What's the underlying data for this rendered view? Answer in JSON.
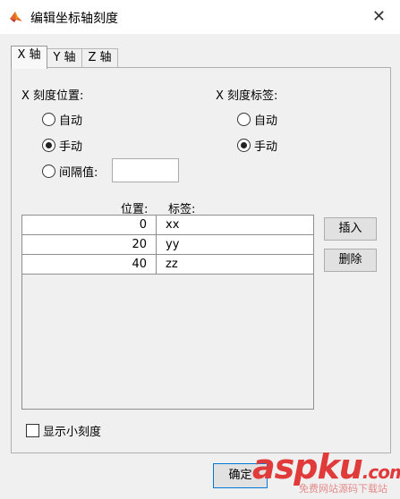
{
  "window": {
    "title": "编辑坐标轴刻度",
    "close": "✕"
  },
  "tabs": [
    {
      "label": "X 轴"
    },
    {
      "label": "Y 轴"
    },
    {
      "label": "Z 轴"
    }
  ],
  "positions": {
    "heading": "X 刻度位置:",
    "auto": "自动",
    "manual": "手动",
    "interval": "间隔值:",
    "interval_value": "",
    "selected": "manual"
  },
  "labels": {
    "heading": "X 刻度标签:",
    "auto": "自动",
    "manual": "手动",
    "selected": "manual"
  },
  "table": {
    "col_position": "位置:",
    "col_label": "标签:",
    "rows": [
      {
        "pos": "0",
        "label": "xx"
      },
      {
        "pos": "20",
        "label": "yy"
      },
      {
        "pos": "40",
        "label": "zz"
      }
    ]
  },
  "buttons": {
    "insert": "插入",
    "delete": "删除",
    "ok": "确定"
  },
  "minor_ticks": {
    "label": "显示小刻度",
    "checked": false
  },
  "watermark": {
    "text": "aspku",
    "tld": ".com",
    "sub": "免费网站源码下载站"
  }
}
